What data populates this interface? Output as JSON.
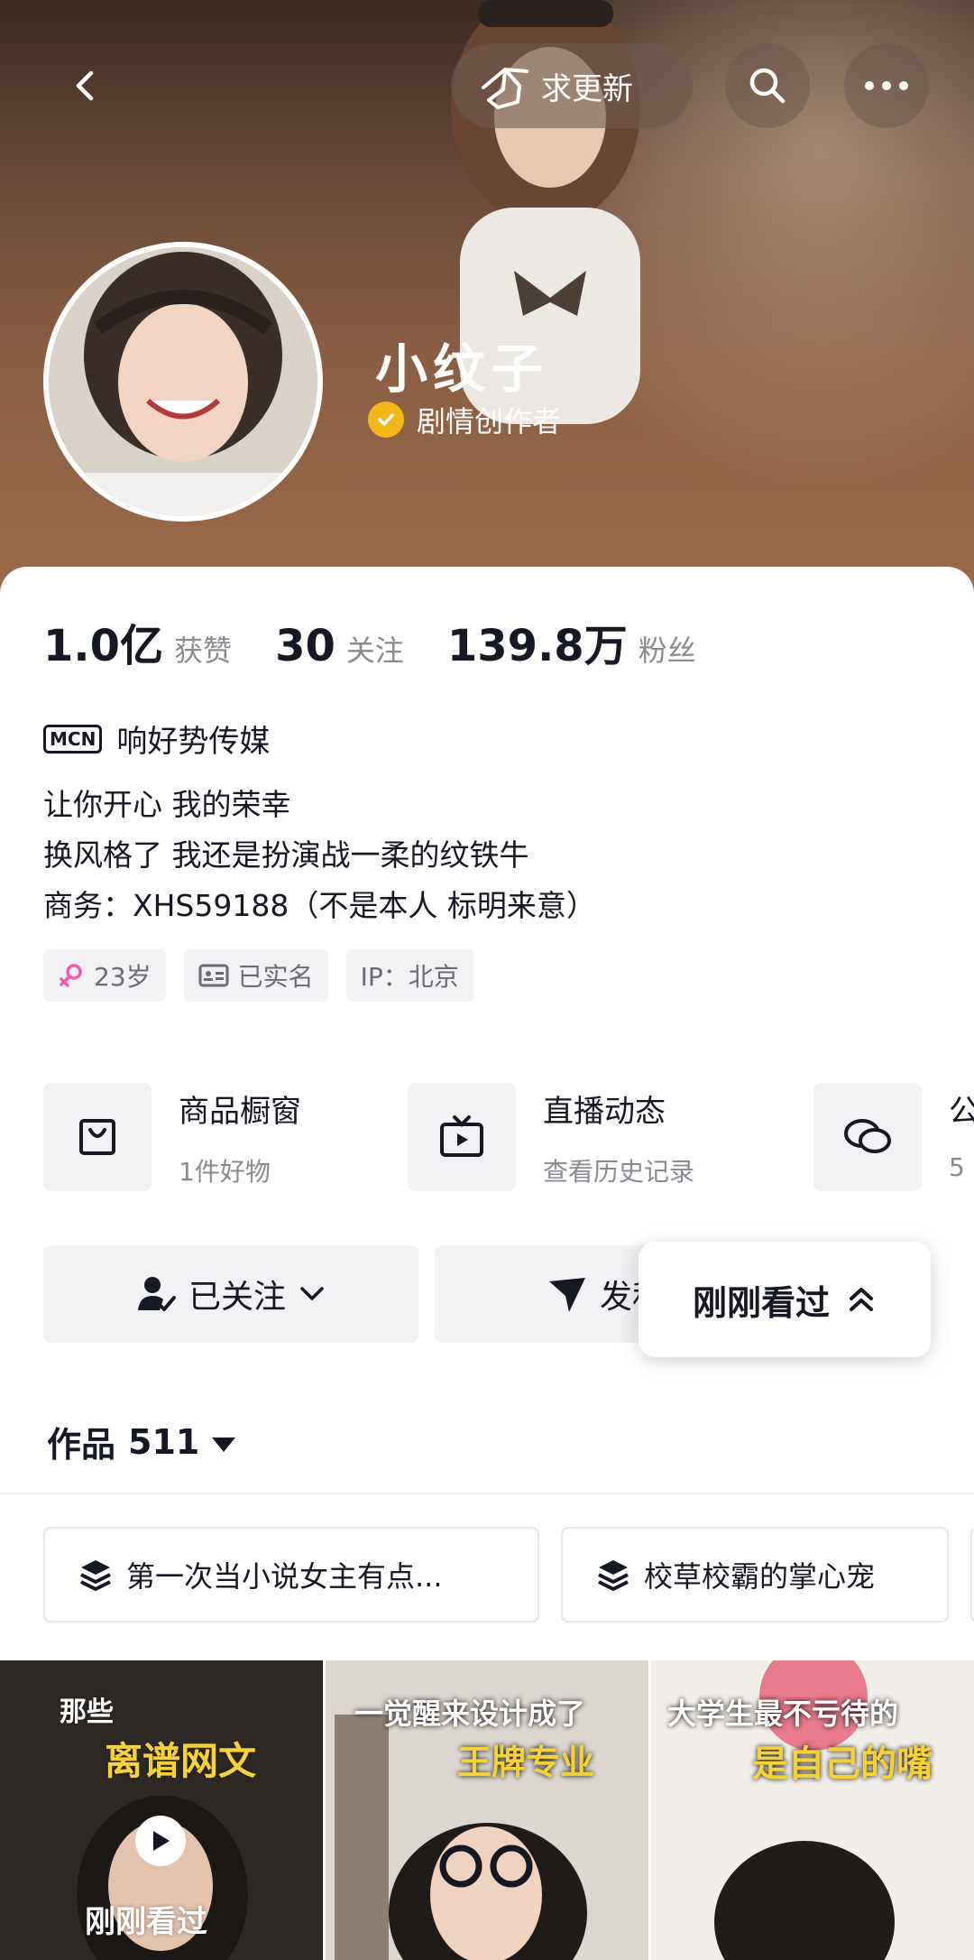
{
  "header": {
    "back_icon": "chevron-left-icon",
    "update_label": "求更新",
    "search_icon": "search-icon",
    "more_icon": "more-horizontal-icon"
  },
  "profile": {
    "name": "小纹子",
    "verify_label": "剧情创作者",
    "verify_color": "#f4b71a"
  },
  "stats": [
    {
      "num": "1.0亿",
      "label": "获赞"
    },
    {
      "num": "30",
      "label": "关注"
    },
    {
      "num": "139.8万",
      "label": "粉丝"
    }
  ],
  "mcn": {
    "badge": "MCN",
    "name": "响好势传媒"
  },
  "bio": [
    "让你开心 我的荣幸",
    "换风格了 我还是扮演战一柔的纹铁牛",
    "商务：XHS59188（不是本人 标明来意）"
  ],
  "tags": [
    {
      "label": "23岁",
      "icon": "female-icon"
    },
    {
      "label": "已实名",
      "icon": "id-card-icon"
    },
    {
      "label": "IP：北京",
      "icon": ""
    }
  ],
  "services": [
    {
      "title": "商品橱窗",
      "sub": "1件好物",
      "icon": "shopping-bag-icon"
    },
    {
      "title": "直播动态",
      "sub": "查看历史记录",
      "icon": "tv-icon"
    },
    {
      "title": "公",
      "sub": "5",
      "icon": "chat-bubbles-icon"
    }
  ],
  "actions": {
    "follow_label": "已关注",
    "message_label": "发私信"
  },
  "works": {
    "label": "作品",
    "count": "511"
  },
  "collections": [
    {
      "label": "第一次当小说女主有点..."
    },
    {
      "label": "校草校霸的掌心宠"
    }
  ],
  "videos": [
    {
      "line1": "那些",
      "line2": "离谱网文",
      "overlay": "刚刚看过"
    },
    {
      "line1": "一觉醒来设计成了",
      "line2": "王牌专业"
    },
    {
      "line1": "大学生最不亏待的",
      "line2": "是自己的嘴"
    }
  ],
  "just_watched": "刚刚看过",
  "colors": {
    "accent_yellow": "#f4b71a",
    "caption_yellow": "#f5d238",
    "female_pink": "#f55bb0",
    "bg_gray": "#f2f2f4"
  }
}
